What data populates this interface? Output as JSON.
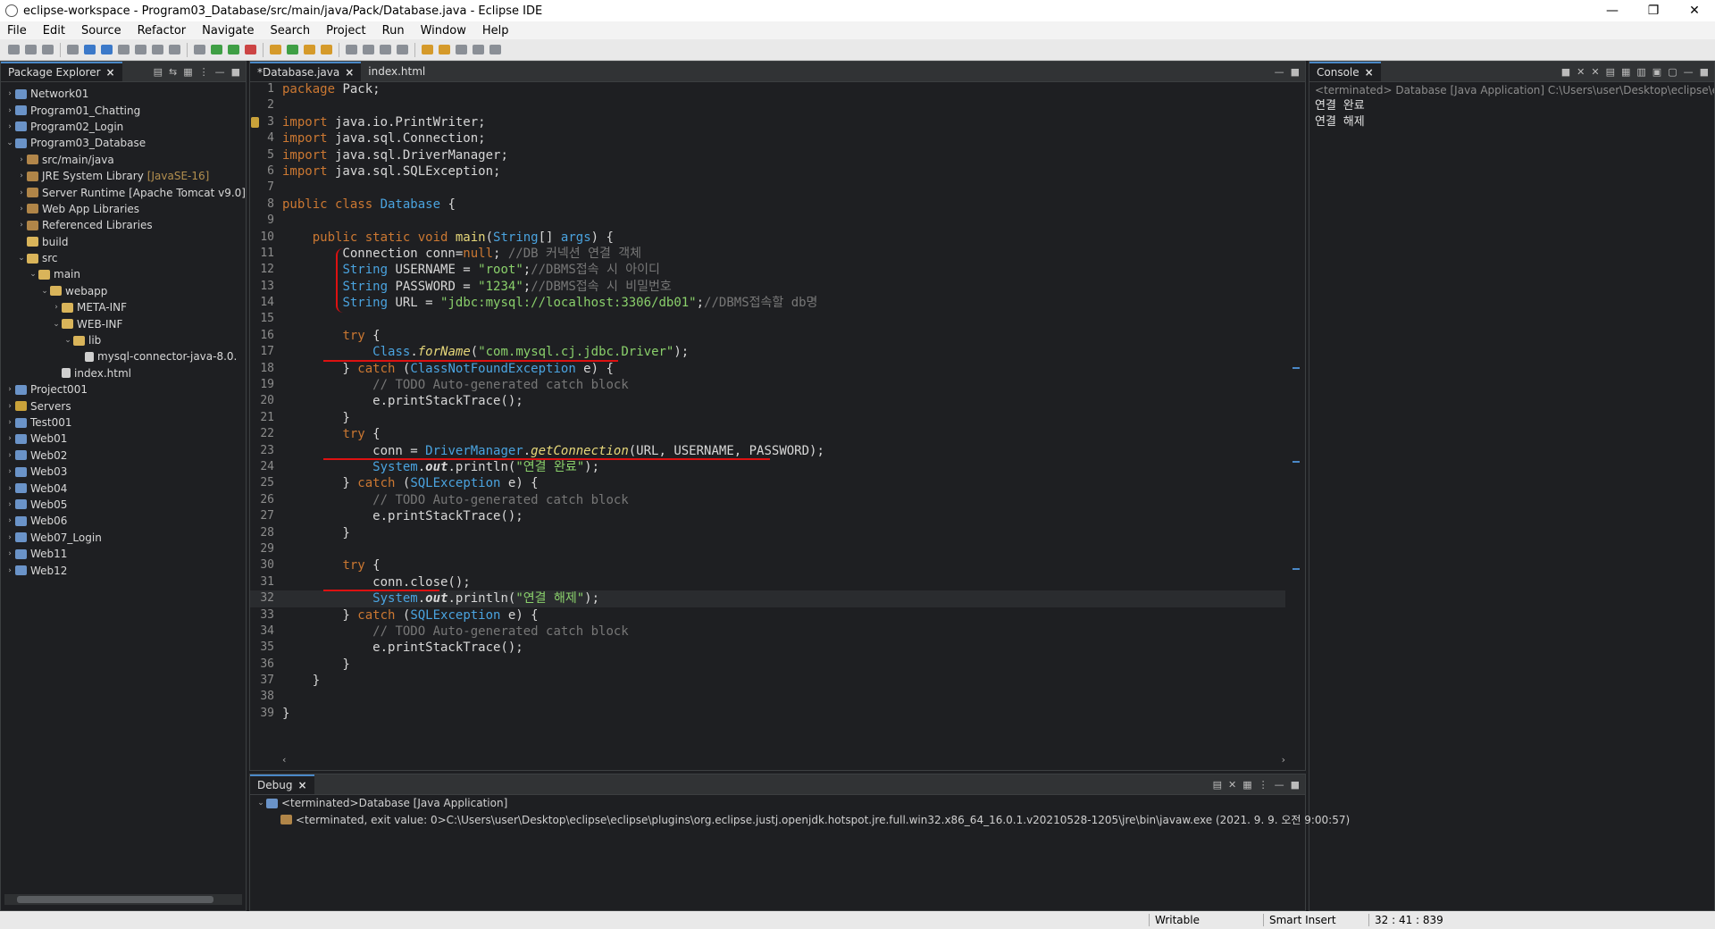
{
  "window": {
    "title": "eclipse-workspace - Program03_Database/src/main/java/Pack/Database.java - Eclipse IDE",
    "controls": [
      "—",
      "❐",
      "✕"
    ]
  },
  "menu": [
    "File",
    "Edit",
    "Source",
    "Refactor",
    "Navigate",
    "Search",
    "Project",
    "Run",
    "Window",
    "Help"
  ],
  "explorer": {
    "tab_label": "Package Explorer",
    "items": [
      {
        "label": "Network01",
        "icon": "web-project",
        "arrow": "›",
        "indent": 0
      },
      {
        "label": "Program01_Chatting",
        "icon": "web-project",
        "arrow": "›",
        "indent": 0
      },
      {
        "label": "Program02_Login",
        "icon": "web-project",
        "arrow": "›",
        "indent": 0
      },
      {
        "label": "Program03_Database",
        "icon": "web-project",
        "arrow": "⌄",
        "indent": 0
      },
      {
        "label": "src/main/java",
        "icon": "package-folder",
        "arrow": "›",
        "indent": 1
      },
      {
        "label": "JRE System Library",
        "suffix": "[JavaSE-16]",
        "icon": "library",
        "arrow": "›",
        "indent": 1
      },
      {
        "label": "Server Runtime [Apache Tomcat v9.0]",
        "icon": "library",
        "arrow": "›",
        "indent": 1
      },
      {
        "label": "Web App Libraries",
        "icon": "library",
        "arrow": "›",
        "indent": 1
      },
      {
        "label": "Referenced Libraries",
        "icon": "library",
        "arrow": "›",
        "indent": 1
      },
      {
        "label": "build",
        "icon": "folder",
        "arrow": "",
        "indent": 1
      },
      {
        "label": "src",
        "icon": "folder",
        "arrow": "⌄",
        "indent": 1
      },
      {
        "label": "main",
        "icon": "folder",
        "arrow": "⌄",
        "indent": 2
      },
      {
        "label": "webapp",
        "icon": "folder",
        "arrow": "⌄",
        "indent": 3
      },
      {
        "label": "META-INF",
        "icon": "folder",
        "arrow": "›",
        "indent": 4
      },
      {
        "label": "WEB-INF",
        "icon": "folder",
        "arrow": "⌄",
        "indent": 4
      },
      {
        "label": "lib",
        "icon": "folder",
        "arrow": "⌄",
        "indent": 5
      },
      {
        "label": "mysql-connector-java-8.0.",
        "icon": "jar-file",
        "arrow": "",
        "indent": 6
      },
      {
        "label": "index.html",
        "icon": "file",
        "arrow": "",
        "indent": 4
      },
      {
        "label": "Project001",
        "icon": "web-project",
        "arrow": "›",
        "indent": 0
      },
      {
        "label": "Servers",
        "icon": "project",
        "arrow": "›",
        "indent": 0
      },
      {
        "label": "Test001",
        "icon": "web-project",
        "arrow": "›",
        "indent": 0
      },
      {
        "label": "Web01",
        "icon": "web-project",
        "arrow": "›",
        "indent": 0
      },
      {
        "label": "Web02",
        "icon": "web-project",
        "arrow": "›",
        "indent": 0
      },
      {
        "label": "Web03",
        "icon": "web-project",
        "arrow": "›",
        "indent": 0
      },
      {
        "label": "Web04",
        "icon": "web-project",
        "arrow": "›",
        "indent": 0
      },
      {
        "label": "Web05",
        "icon": "web-project",
        "arrow": "›",
        "indent": 0
      },
      {
        "label": "Web06",
        "icon": "web-project",
        "arrow": "›",
        "indent": 0
      },
      {
        "label": "Web07_Login",
        "icon": "web-project",
        "arrow": "›",
        "indent": 0
      },
      {
        "label": "Web11",
        "icon": "web-project",
        "arrow": "›",
        "indent": 0
      },
      {
        "label": "Web12",
        "icon": "web-project",
        "arrow": "›",
        "indent": 0
      }
    ]
  },
  "editor": {
    "tabs": [
      {
        "label": "*Database.java",
        "active": true
      },
      {
        "label": "index.html",
        "active": false
      }
    ],
    "current_line": 32,
    "lines": [
      [
        [
          "k",
          "package"
        ],
        [
          "p",
          " Pack;"
        ]
      ],
      [],
      [
        [
          "k",
          "import"
        ],
        [
          "p",
          " java.io.PrintWriter;"
        ]
      ],
      [
        [
          "k",
          "import"
        ],
        [
          "p",
          " java.sql.Connection;"
        ]
      ],
      [
        [
          "k",
          "import"
        ],
        [
          "p",
          " java.sql.DriverManager;"
        ]
      ],
      [
        [
          "k",
          "import"
        ],
        [
          "p",
          " java.sql.SQLException;"
        ]
      ],
      [],
      [
        [
          "k",
          "public class "
        ],
        [
          "t",
          "Database"
        ],
        [
          "p",
          " {"
        ]
      ],
      [],
      [
        [
          "p",
          "    "
        ],
        [
          "k",
          "public static void "
        ],
        [
          "m",
          "main"
        ],
        [
          "p",
          "("
        ],
        [
          "t",
          "String"
        ],
        [
          "p",
          "[] "
        ],
        [
          "t",
          "args"
        ],
        [
          "p",
          ") {"
        ]
      ],
      [
        [
          "p",
          "        Connection conn="
        ],
        [
          "k",
          "null"
        ],
        [
          "p",
          "; "
        ],
        [
          "c",
          "//DB 커넥션 연결 객체"
        ]
      ],
      [
        [
          "p",
          "        "
        ],
        [
          "t",
          "String"
        ],
        [
          "p",
          " USERNAME = "
        ],
        [
          "s",
          "\"root\""
        ],
        [
          "p",
          ";"
        ],
        [
          "c",
          "//DBMS접속 시 아이디"
        ]
      ],
      [
        [
          "p",
          "        "
        ],
        [
          "t",
          "String"
        ],
        [
          "p",
          " PASSWORD = "
        ],
        [
          "s",
          "\"1234\""
        ],
        [
          "p",
          ";"
        ],
        [
          "c",
          "//DBMS접속 시 비밀번호"
        ]
      ],
      [
        [
          "p",
          "        "
        ],
        [
          "t",
          "String"
        ],
        [
          "p",
          " URL = "
        ],
        [
          "s",
          "\"jdbc:mysql://localhost:3306/db01\""
        ],
        [
          "p",
          ";"
        ],
        [
          "c",
          "//DBMS접속할 db명"
        ]
      ],
      [],
      [
        [
          "p",
          "        "
        ],
        [
          "k",
          "try"
        ],
        [
          "p",
          " {"
        ]
      ],
      [
        [
          "p",
          "            "
        ],
        [
          "t",
          "Class"
        ],
        [
          "p",
          "."
        ],
        [
          "mi",
          "forName"
        ],
        [
          "p",
          "("
        ],
        [
          "s",
          "\"com.mysql.cj.jdbc.Driver\""
        ],
        [
          "p",
          ");"
        ]
      ],
      [
        [
          "p",
          "        } "
        ],
        [
          "k",
          "catch"
        ],
        [
          "p",
          " ("
        ],
        [
          "t",
          "ClassNotFoundException"
        ],
        [
          "p",
          " e) {"
        ]
      ],
      [
        [
          "p",
          "            "
        ],
        [
          "c",
          "// TODO Auto-generated catch block"
        ]
      ],
      [
        [
          "p",
          "            e.printStackTrace();"
        ]
      ],
      [
        [
          "p",
          "        }"
        ]
      ],
      [
        [
          "p",
          "        "
        ],
        [
          "k",
          "try"
        ],
        [
          "p",
          " {"
        ]
      ],
      [
        [
          "p",
          "            conn = "
        ],
        [
          "t",
          "DriverManager"
        ],
        [
          "p",
          "."
        ],
        [
          "mi",
          "getConnection"
        ],
        [
          "p",
          "(URL, USERNAME, PASSWORD);"
        ]
      ],
      [
        [
          "p",
          "            "
        ],
        [
          "t",
          "System"
        ],
        [
          "p",
          "."
        ],
        [
          "st",
          "out"
        ],
        [
          "p",
          ".println("
        ],
        [
          "s",
          "\"연결 완료\""
        ],
        [
          "p",
          ");"
        ]
      ],
      [
        [
          "p",
          "        } "
        ],
        [
          "k",
          "catch"
        ],
        [
          "p",
          " ("
        ],
        [
          "t",
          "SQLException"
        ],
        [
          "p",
          " e) {"
        ]
      ],
      [
        [
          "p",
          "            "
        ],
        [
          "c",
          "// TODO Auto-generated catch block"
        ]
      ],
      [
        [
          "p",
          "            e.printStackTrace();"
        ]
      ],
      [
        [
          "p",
          "        }"
        ]
      ],
      [],
      [
        [
          "p",
          "        "
        ],
        [
          "k",
          "try"
        ],
        [
          "p",
          " {"
        ]
      ],
      [
        [
          "p",
          "            conn.close();"
        ]
      ],
      [
        [
          "p",
          "            "
        ],
        [
          "t",
          "System"
        ],
        [
          "p",
          "."
        ],
        [
          "st",
          "out"
        ],
        [
          "p",
          ".println("
        ],
        [
          "s",
          "\"연결 해제\""
        ],
        [
          "p",
          ");"
        ]
      ],
      [
        [
          "p",
          "        } "
        ],
        [
          "k",
          "catch"
        ],
        [
          "p",
          " ("
        ],
        [
          "t",
          "SQLException"
        ],
        [
          "p",
          " e) {"
        ]
      ],
      [
        [
          "p",
          "            "
        ],
        [
          "c",
          "// TODO Auto-generated catch block"
        ]
      ],
      [
        [
          "p",
          "            e.printStackTrace();"
        ]
      ],
      [
        [
          "p",
          "        }"
        ]
      ],
      [
        [
          "p",
          "    }"
        ]
      ],
      [],
      [
        [
          "p",
          "}"
        ]
      ]
    ]
  },
  "console": {
    "tab_label": "Console",
    "header": "<terminated> Database [Java Application] C:\\Users\\user\\Desktop\\eclipse\\eclipse\\plugins\\org.eclipse.justj.openjdk.hotspot.jre.full.win32.x86_64_16.0.1.v20210528-1205\\jre\\bin\\javaw.exe",
    "output": [
      "연결 완료",
      "연결 해제"
    ]
  },
  "debug": {
    "tab_label": "Debug",
    "launch": "<terminated>Database [Java Application]",
    "process": "<terminated, exit value: 0>C:\\Users\\user\\Desktop\\eclipse\\eclipse\\plugins\\org.eclipse.justj.openjdk.hotspot.jre.full.win32.x86_64_16.0.1.v20210528-1205\\jre\\bin\\javaw.exe (2021. 9. 9. 오전 9:00:57)"
  },
  "status": {
    "writable": "Writable",
    "insert_mode": "Smart Insert",
    "position": "32 : 41 : 839"
  }
}
